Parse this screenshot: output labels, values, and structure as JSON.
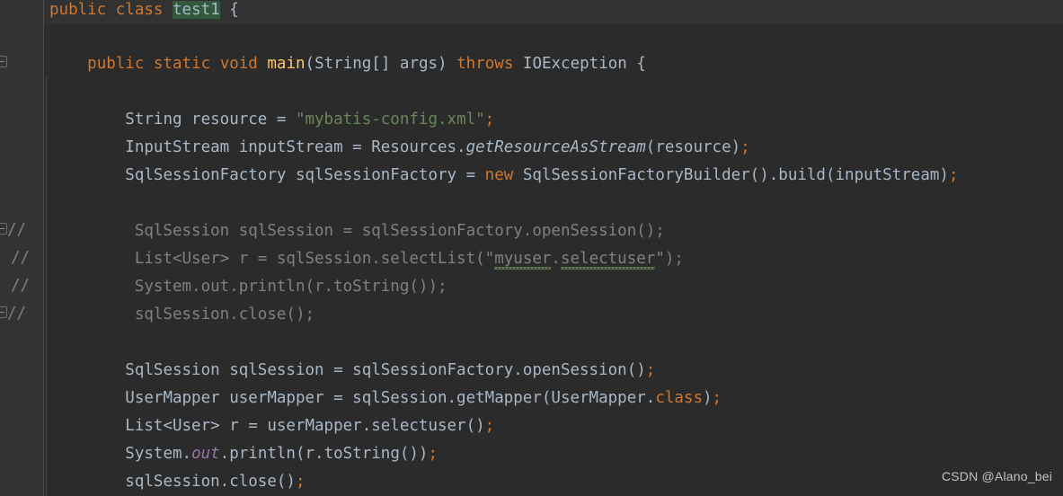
{
  "editor": {
    "language": "java",
    "theme": "darcula",
    "background": "#2b2b2b",
    "gutter_background": "#313335",
    "caret_row_background": "#323232",
    "colors": {
      "keyword": "#cc7832",
      "text": "#a9b7c6",
      "string": "#6a8759",
      "method": "#ffc66d",
      "comment": "#808080",
      "static_field": "#9876aa",
      "identifier_highlight": "#32593d",
      "typo_squiggle": "#6a8759"
    }
  },
  "gutter": {
    "comment_marks": [
      "//",
      "//",
      "//",
      "//"
    ],
    "fold_icon_name": "code-fold-icon"
  },
  "code": {
    "line1": {
      "kw_public": "public",
      "sp1": " ",
      "kw_class": "class",
      "sp2": " ",
      "name": "test1",
      "sp3": " ",
      "brace": "{"
    },
    "line3": {
      "kw_public": "public",
      "kw_static": "static",
      "kw_void": "void",
      "method": "main",
      "params": "(String[] args)",
      "kw_throws": "throws",
      "exception": "IOException",
      "brace": "{"
    },
    "line5": {
      "type": "String resource = ",
      "value": "\"mybatis-config.xml\"",
      "semi": ";"
    },
    "line6": {
      "head": "InputStream inputStream = Resources.",
      "method": "getResourceAsStream",
      "tail": "(resource)",
      "semi": ";"
    },
    "line7": {
      "head": "SqlSessionFactory sqlSessionFactory = ",
      "kw_new": "new",
      "tail": " SqlSessionFactoryBuilder().build(inputStream)",
      "semi": ";"
    },
    "line9_comment": "SqlSession sqlSession = sqlSessionFactory.openSession();",
    "line10_comment_a": "List<User> r = sqlSession.selectList(\"",
    "line10_typo1": "myuser",
    "line10_dot": ".",
    "line10_typo2": "selectuser",
    "line10_comment_b": "\");",
    "line11_comment": "System.out.println(r.toString());",
    "line12_comment": "sqlSession.close();",
    "line14": {
      "body": "SqlSession sqlSession = sqlSessionFactory.openSession()",
      "semi": ";"
    },
    "line15": {
      "head": "UserMapper userMapper = sqlSession.getMapper(UserMapper.",
      "kw_class": "class",
      "tail": ")",
      "semi": ";"
    },
    "line16": {
      "body": "List<User> r = userMapper.selectuser()",
      "semi": ";"
    },
    "line17": {
      "head": "System.",
      "static_field": "out",
      "tail": ".println(r.toString())",
      "semi": ";"
    },
    "line18": {
      "body": "sqlSession.close()",
      "semi": ";"
    }
  },
  "watermark": {
    "text": "CSDN @Alano_bei"
  }
}
